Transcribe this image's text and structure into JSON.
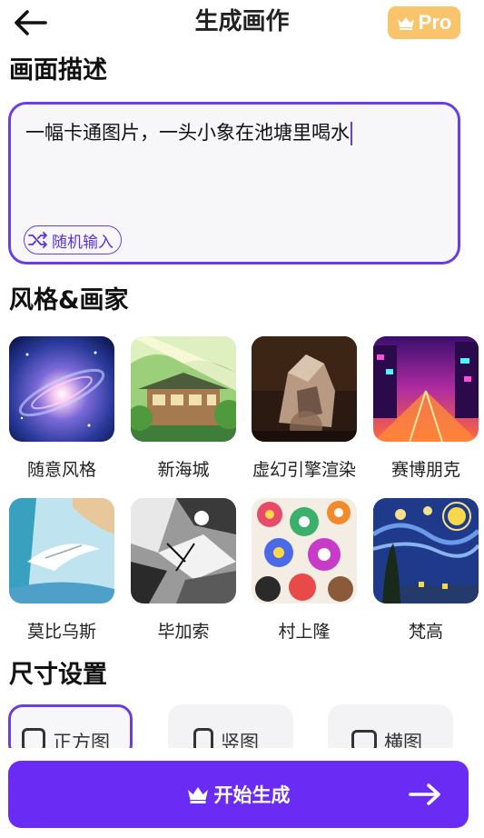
{
  "header": {
    "title": "生成画作",
    "pro_label": "Pro"
  },
  "prompt_section": {
    "title": "画面描述",
    "text": "一幅卡通图片，一头小象在池塘里喝水",
    "random_label": "随机输入"
  },
  "styles_section": {
    "title": "风格&画家",
    "items": [
      {
        "label": "随意风格",
        "icon": "galaxy"
      },
      {
        "label": "新海城",
        "icon": "anime-house"
      },
      {
        "label": "虚幻引擎渲染",
        "icon": "unreal-render"
      },
      {
        "label": "赛博朋克",
        "icon": "cyberpunk-street"
      },
      {
        "label": "莫比乌斯",
        "icon": "moebius"
      },
      {
        "label": "毕加索",
        "icon": "picasso"
      },
      {
        "label": "村上隆",
        "icon": "murakami-flowers"
      },
      {
        "label": "梵高",
        "icon": "starry-night"
      }
    ]
  },
  "size_section": {
    "title": "尺寸设置",
    "options": [
      {
        "label": "正方图",
        "selected": true
      },
      {
        "label": "竖图",
        "selected": false
      },
      {
        "label": "横图",
        "selected": false
      }
    ]
  },
  "start_button": {
    "label": "开始生成"
  },
  "colors": {
    "accent": "#6a2cf5",
    "pro": "#f9c46b"
  }
}
